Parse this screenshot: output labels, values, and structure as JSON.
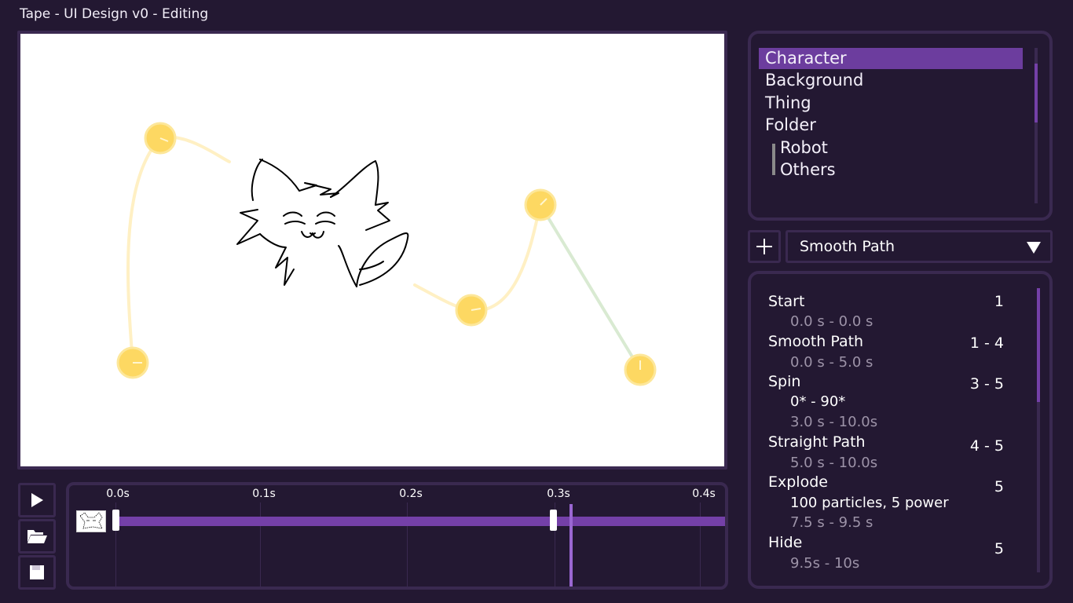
{
  "window": {
    "title": "Tape - UI Design v0 - Editing"
  },
  "timeline": {
    "ticks": [
      "0.0s",
      "0.1s",
      "0.2s",
      "0.3s",
      "0.4s"
    ],
    "controls": {
      "play_icon": "play-icon",
      "open_icon": "folder-icon",
      "save_icon": "save-icon"
    }
  },
  "objects": {
    "items": [
      {
        "label": "Character",
        "selected": true
      },
      {
        "label": "Background"
      },
      {
        "label": "Thing"
      },
      {
        "label": "Folder"
      },
      {
        "label": "Robot",
        "child": true
      },
      {
        "label": "Others",
        "child": true
      }
    ]
  },
  "toolbar": {
    "add_icon": "plus-icon",
    "dropdown_value": "Smooth Path"
  },
  "animations": [
    {
      "name": "Start",
      "range": "1",
      "lines": [
        "0.0 s - 0.0 s"
      ]
    },
    {
      "name": "Smooth Path",
      "range": "1 - 4",
      "lines": [
        "0.0 s - 5.0 s"
      ]
    },
    {
      "name": "Spin",
      "range": "3 - 5",
      "detail": "0* - 90*",
      "lines": [
        "3.0 s - 10.0s"
      ]
    },
    {
      "name": "Straight Path",
      "range": "4 - 5",
      "lines": [
        "5.0 s - 10.0s"
      ]
    },
    {
      "name": "Explode",
      "range": "5",
      "detail": "100 particles, 5 power",
      "lines": [
        "7.5 s - 9.5 s"
      ]
    },
    {
      "name": "Hide",
      "range": "5",
      "lines": [
        "9.5s - 10s"
      ]
    }
  ],
  "colors": {
    "background": "#231832",
    "panel_border": "#3a2950",
    "accent": "#7440a8",
    "selected": "#6c3d9e",
    "path_yellow": "#fff0c4",
    "path_green": "#d9ead2",
    "node_yellow": "#fdd862"
  }
}
